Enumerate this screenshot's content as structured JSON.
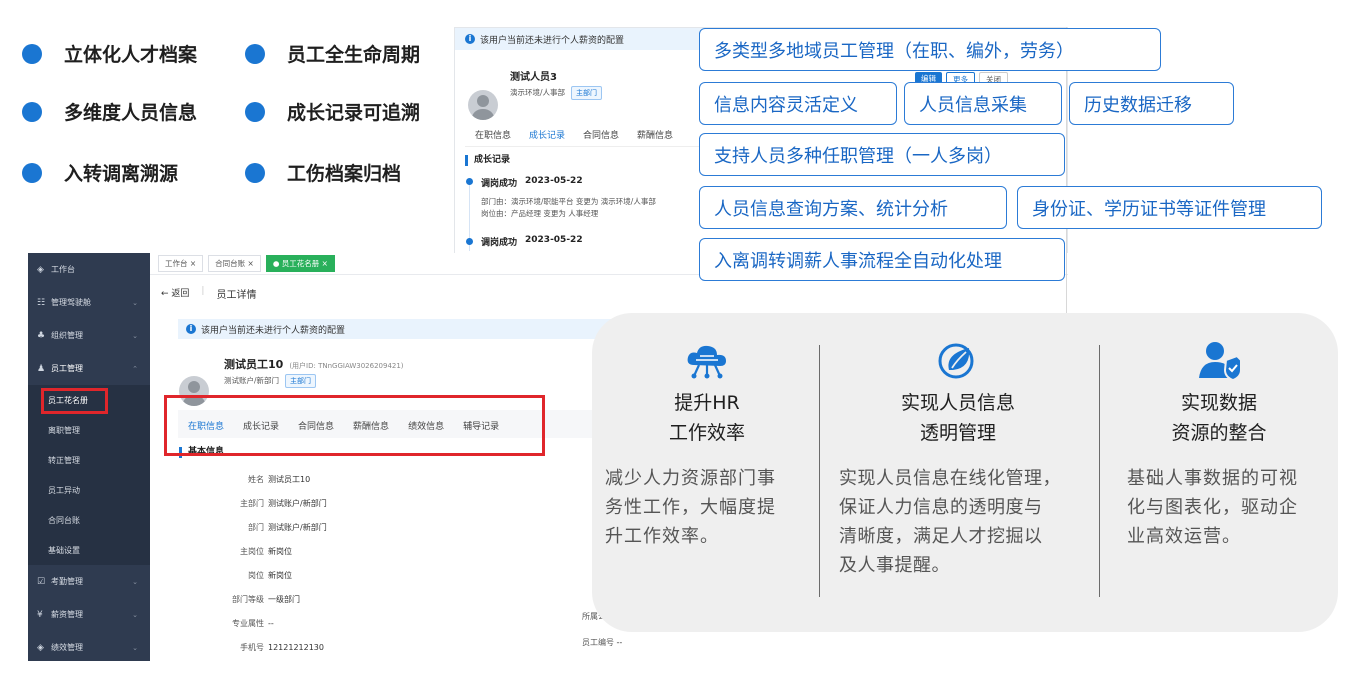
{
  "features": [
    "立体化人才档案",
    "员工全生命周期",
    "多维度人员信息",
    "成长记录可追溯",
    "入转调离溯源",
    "工伤档案归档"
  ],
  "back_panel": {
    "alert": "该用户当前还未进行个人薪资的配置",
    "user_name": "测试人员3",
    "user_dept": "演示环境/人事部",
    "dept_tag": "主部门",
    "actions": [
      "编辑",
      "更多",
      "关闭"
    ],
    "tabs": [
      "在职信息",
      "成长记录",
      "合同信息",
      "薪酬信息"
    ],
    "section_title": "成长记录",
    "records": [
      {
        "title": "调岗成功",
        "date": "2023-05-22",
        "line1": "部门由：演示环境/职能平台 变更为 演示环境/人事部",
        "line2": "岗位由：产品经理 变更为 人事经理"
      },
      {
        "title": "调岗成功",
        "date": "2023-05-22"
      }
    ]
  },
  "sidebar": {
    "items": [
      {
        "label": "工作台",
        "icon": "dashboard-icon",
        "glyph": "◈"
      },
      {
        "label": "管理驾驶舱",
        "icon": "cockpit-icon",
        "glyph": "☷"
      },
      {
        "label": "组织管理",
        "icon": "org-icon",
        "glyph": "♣"
      },
      {
        "label": "员工管理",
        "icon": "user-icon",
        "glyph": "♟"
      }
    ],
    "sub_items": [
      "员工花名册",
      "离职管理",
      "转正管理",
      "员工异动",
      "合同台账",
      "基础设置"
    ],
    "bottom_items": [
      {
        "label": "考勤管理",
        "icon": "attendance-icon",
        "glyph": "☑"
      },
      {
        "label": "薪资管理",
        "icon": "salary-icon",
        "glyph": "¥"
      },
      {
        "label": "绩效管理",
        "icon": "performance-icon",
        "glyph": "◈"
      }
    ]
  },
  "main": {
    "tabs": [
      "工作台 ×",
      "合同台账 ×",
      "● 员工花名册 ×"
    ],
    "back_label": "← 返回",
    "page_title": "员工详情",
    "alert": "该用户当前还未进行个人薪资的配置",
    "user_name": "测试员工10",
    "user_id": "(用户ID: TNnGGIAW3026209421)",
    "user_dept": "测试账户/新部门",
    "dept_tag": "主部门",
    "tabs_detail": [
      "在职信息",
      "成长记录",
      "合同信息",
      "薪酬信息",
      "绩效信息",
      "辅导记录"
    ],
    "section_title": "基本信息",
    "fields": [
      {
        "label": "姓名",
        "value": "测试员工10"
      },
      {
        "label": "主部门",
        "value": "测试账户/新部门"
      },
      {
        "label": "部门",
        "value": "测试账户/新部门"
      },
      {
        "label": "主岗位",
        "value": "新岗位"
      },
      {
        "label": "岗位",
        "value": "新岗位"
      },
      {
        "label": "部门等级",
        "value": "一级部门"
      },
      {
        "label": "专业属性",
        "value": "--"
      },
      {
        "label": "手机号",
        "value": "12121212130"
      }
    ],
    "right_fields": [
      {
        "label": "所属公司",
        "value": ""
      },
      {
        "label": "员工编号",
        "value": "--"
      }
    ]
  },
  "tags": [
    "多类型多地域员工管理（在职、编外，劳务）",
    "信息内容灵活定义",
    "人员信息采集",
    "历史数据迁移",
    "支持人员多种任职管理（一人多岗）",
    "人员信息查询方案、统计分析",
    "身份证、学历证书等证件管理",
    "入离调转调薪人事流程全自动化处理"
  ],
  "values": [
    {
      "icon": "cloud-network-icon",
      "title1": "提升HR",
      "title2": "工作效率",
      "desc": [
        "减少人力资源部门事",
        "务性工作，大幅度提",
        "升工作效率。"
      ]
    },
    {
      "icon": "leaf-globe-icon",
      "title1": "实现人员信息",
      "title2": "透明管理",
      "desc": [
        "实现人员信息在线化管理，",
        "保证人力信息的透明度与",
        "清晰度，满足人才挖掘以",
        "及人事提醒。"
      ]
    },
    {
      "icon": "user-shield-icon",
      "title1": "实现数据",
      "title2": "资源的整合",
      "desc": [
        "基础人事数据的可视",
        "化与图表化，驱动企",
        "业高效运营。"
      ]
    }
  ],
  "colors": {
    "accent": "#1a76d2",
    "sidebar": "#2f3b50",
    "highlight": "#e0262b",
    "tag_border": "#2c7bd6"
  }
}
